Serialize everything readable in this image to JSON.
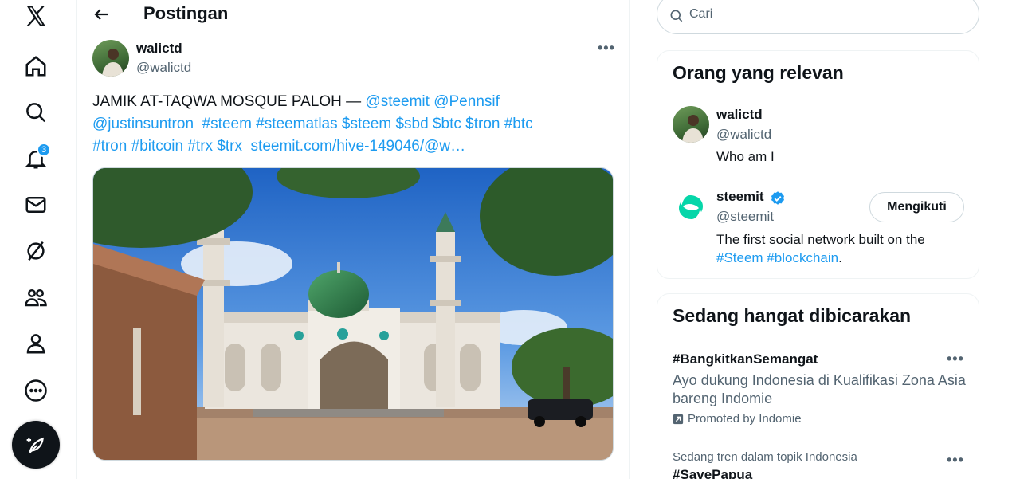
{
  "colors": {
    "accent": "#1d9bf0",
    "text": "#0f1419",
    "muted": "#536471"
  },
  "nav": {
    "items": [
      {
        "icon": "x-logo-icon"
      },
      {
        "icon": "home-icon"
      },
      {
        "icon": "search-icon"
      },
      {
        "icon": "bell-icon",
        "badge": "3"
      },
      {
        "icon": "mail-icon"
      },
      {
        "icon": "grok-icon"
      },
      {
        "icon": "communities-icon"
      },
      {
        "icon": "profile-icon"
      },
      {
        "icon": "more-circle-icon"
      },
      {
        "icon": "compose-feather-icon"
      }
    ],
    "notifications_badge": "3"
  },
  "header": {
    "title": "Postingan"
  },
  "post": {
    "author_name": "walictd",
    "author_handle": "@walictd",
    "text_plain": "JAMIK AT-TAQWA MOSQUE PALOH — ",
    "mention_1": "@steemit",
    "mention_2": "@Pennsif",
    "mention_3": "@justinsuntron",
    "tags_line2": "#steem #steematlas $steem $sbd $btc $tron #btc",
    "tags_line3": "#tron #bitcoin #trx $trx",
    "link": "steemit.com/hive-149046/@w…"
  },
  "search": {
    "placeholder": "Cari"
  },
  "relevant": {
    "title": "Orang yang relevan",
    "people": [
      {
        "name": "walictd",
        "handle": "@walictd",
        "bio": "Who am I"
      },
      {
        "name": "steemit",
        "handle": "@steemit",
        "verified": true,
        "button": "Mengikuti",
        "bio_plain": "The first social network built on the",
        "bio_tags": "#Steem #blockchain",
        "bio_end": "."
      }
    ]
  },
  "trending": {
    "title": "Sedang hangat dibicarakan",
    "items": [
      {
        "tag": "#BangkitkanSemangat",
        "desc": "Ayo dukung Indonesia di Kualifikasi Zona Asia bareng Indomie",
        "promoted": "Promoted by Indomie"
      },
      {
        "meta": "Sedang tren dalam topik Indonesia",
        "tag": "#SavePapua"
      }
    ]
  }
}
